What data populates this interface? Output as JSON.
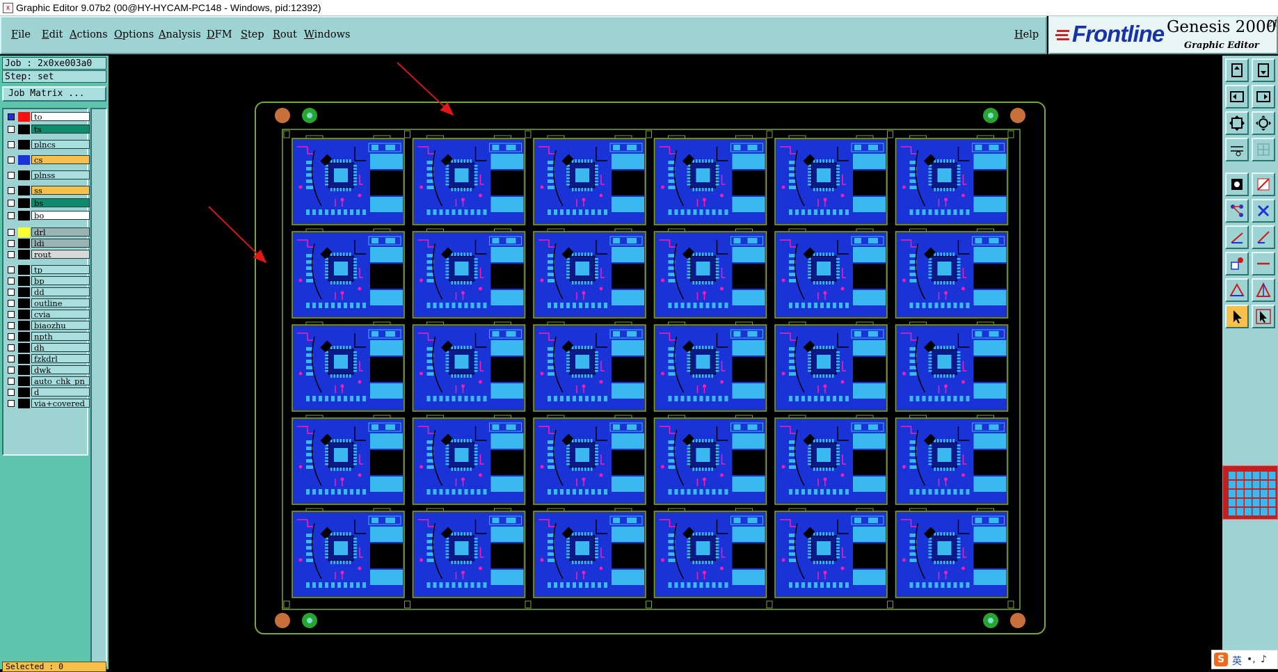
{
  "window": {
    "title": "Graphic Editor 9.07b2 (00@HY-HYCAM-PC148 - Windows, pid:12392)"
  },
  "menu": [
    "File",
    "Edit",
    "Actions",
    "Options",
    "Analysis",
    "DFM",
    "Step",
    "Rout",
    "Windows"
  ],
  "help_label": "Help",
  "logo": {
    "brand": "Frontline",
    "product": "Genesis 2000",
    "sup": "21",
    "subtitle": "Graphic Editor"
  },
  "job": {
    "job_text": "Job : 2x0xe003a0",
    "step_text": "Step: set",
    "matrix_label": "Job Matrix ..."
  },
  "layers": [
    {
      "name": "to",
      "swatch": "#ff1010",
      "highlight": "#ffffff",
      "state": "work"
    },
    {
      "name": "ts",
      "swatch": "#000000",
      "highlight": "#0e8c6c",
      "state": "affected"
    },
    {
      "name": "plncs",
      "swatch": "#000000",
      "highlight": "#a8dede",
      "state": "off"
    },
    {
      "name": "cs",
      "swatch": "#1a33d6",
      "highlight": "#f6c04a",
      "state": "affected"
    },
    {
      "name": "plnss",
      "swatch": "#000000",
      "highlight": "#a8dede",
      "state": "off"
    },
    {
      "name": "ss",
      "swatch": "#000000",
      "highlight": "#f6c04a",
      "state": "off"
    },
    {
      "name": "bs",
      "swatch": "#000000",
      "highlight": "#0e8c6c",
      "state": "off"
    },
    {
      "name": "bo",
      "swatch": "#000000",
      "highlight": "#ffffff",
      "state": "off"
    },
    {
      "name": "drl",
      "swatch": "#ffff30",
      "highlight": "#9ab4b4",
      "state": "off"
    },
    {
      "name": "ldi",
      "swatch": "#000000",
      "highlight": "#9ab4b4",
      "state": "off"
    },
    {
      "name": "rout",
      "swatch": "#000000",
      "highlight": "#d8d8d8",
      "state": "off"
    },
    {
      "name": "tp",
      "swatch": "#000000",
      "highlight": "#a8dede",
      "state": "off"
    },
    {
      "name": "bp",
      "swatch": "#000000",
      "highlight": "#a8dede",
      "state": "off"
    },
    {
      "name": "dd",
      "swatch": "#000000",
      "highlight": "#a8dede",
      "state": "off"
    },
    {
      "name": "outline",
      "swatch": "#000000",
      "highlight": "#a8dede",
      "state": "off"
    },
    {
      "name": "cvia",
      "swatch": "#000000",
      "highlight": "#a8dede",
      "state": "off"
    },
    {
      "name": "biaozhu",
      "swatch": "#000000",
      "highlight": "#a8dede",
      "state": "off"
    },
    {
      "name": "npth",
      "swatch": "#000000",
      "highlight": "#a8dede",
      "state": "off"
    },
    {
      "name": "dh",
      "swatch": "#000000",
      "highlight": "#a8dede",
      "state": "off"
    },
    {
      "name": "fzkdrl",
      "swatch": "#000000",
      "highlight": "#a8dede",
      "state": "off"
    },
    {
      "name": "dwk",
      "swatch": "#000000",
      "highlight": "#a8dede",
      "state": "off"
    },
    {
      "name": "auto_chk_pn",
      "swatch": "#000000",
      "highlight": "#a8dede",
      "state": "off"
    },
    {
      "name": "d",
      "swatch": "#000000",
      "highlight": "#a8dede",
      "state": "off"
    },
    {
      "name": "via+covered",
      "swatch": "#000000",
      "highlight": "#a8dede",
      "state": "off"
    }
  ],
  "selected_text": "Selected : 0",
  "panel": {
    "rows": 5,
    "cols": 6
  },
  "tools": [
    "move-top-icon",
    "move-bottom-icon",
    "move-left-icon",
    "move-right-icon",
    "zoom-fit-icon",
    "zoom-center-icon",
    "grid-snap-icon",
    "grid-icon",
    "pad-add-icon",
    "line-add-icon",
    "node-edit-icon",
    "cross-icon",
    "line-draw-icon",
    "arc-draw-icon",
    "pad-select-icon",
    "minus-icon",
    "triangle-icon",
    "triangle-select-icon",
    "pointer-icon",
    "pointer-select-icon"
  ],
  "ime": {
    "lang": "英"
  },
  "colors": {
    "menubar": "#9ed3d3",
    "panel": "#5fc4ac",
    "board_outline": "#7ca638",
    "copper": "#1a33d6",
    "pad": "#3ab8f0",
    "silk": "#ff1ab8"
  }
}
